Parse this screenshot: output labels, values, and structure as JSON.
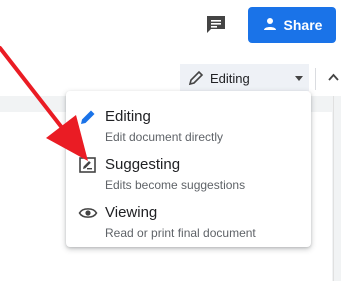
{
  "header": {
    "comment_icon": "comment-icon",
    "share_label": "Share",
    "share_icon": "person-add-icon"
  },
  "toolbar": {
    "mode_label": "Editing",
    "mode_icon": "pencil-icon"
  },
  "menu": {
    "items": [
      {
        "title": "Editing",
        "subtitle": "Edit document directly",
        "icon": "pencil-icon"
      },
      {
        "title": "Suggesting",
        "subtitle": "Edits become suggestions",
        "icon": "suggest-edit-icon"
      },
      {
        "title": "Viewing",
        "subtitle": "Read or print final document",
        "icon": "eye-icon"
      }
    ]
  },
  "colors": {
    "accent": "#1a73e8",
    "annotation": "#ea1c24"
  }
}
